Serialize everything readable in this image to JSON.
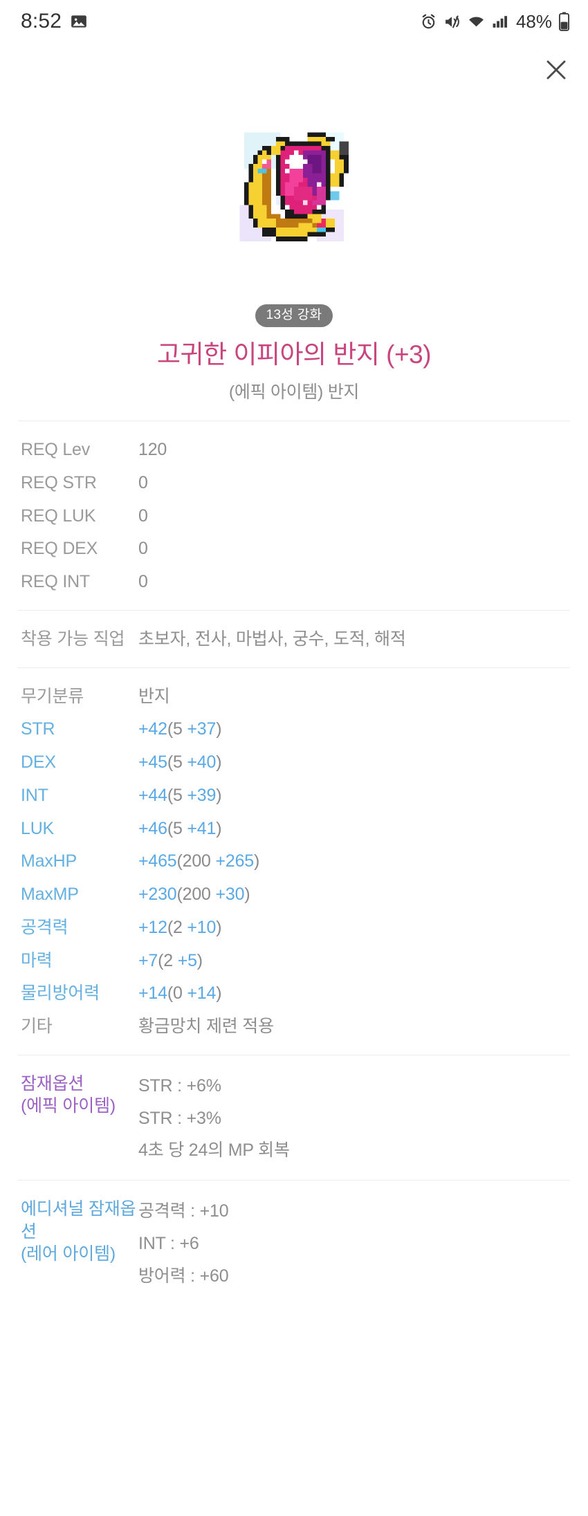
{
  "status_bar": {
    "time": "8:52",
    "battery_percent": "48%",
    "icons": [
      "image-icon",
      "alarm-icon",
      "mute-icon",
      "wifi-icon",
      "signal-icon",
      "battery-icon"
    ]
  },
  "header": {
    "close_label": "✕"
  },
  "item": {
    "icon_name": "epic-ring-item-icon",
    "star_badge": "13성 강화",
    "name": "고귀한 이피아의 반지 (+3)",
    "subtitle": "(에픽 아이템) 반지"
  },
  "requirements": [
    {
      "label": "REQ Lev",
      "value": "120"
    },
    {
      "label": "REQ STR",
      "value": "0"
    },
    {
      "label": "REQ LUK",
      "value": "0"
    },
    {
      "label": "REQ DEX",
      "value": "0"
    },
    {
      "label": "REQ INT",
      "value": "0"
    }
  ],
  "jobs": {
    "label": "착용 가능 직업",
    "value": "초보자, 전사, 마법사, 궁수, 도적, 해적"
  },
  "category": {
    "label": "무기분류",
    "value": "반지"
  },
  "stats": [
    {
      "label": "STR",
      "total": "+42",
      "base": "(5 ",
      "bonus": "+37",
      "close": ")"
    },
    {
      "label": "DEX",
      "total": "+45",
      "base": "(5 ",
      "bonus": "+40",
      "close": ")"
    },
    {
      "label": "INT",
      "total": "+44",
      "base": "(5 ",
      "bonus": "+39",
      "close": ")"
    },
    {
      "label": "LUK",
      "total": "+46",
      "base": "(5 ",
      "bonus": "+41",
      "close": ")"
    },
    {
      "label": "MaxHP",
      "total": "+465",
      "base": "(200 ",
      "bonus": "+265",
      "close": ")"
    },
    {
      "label": "MaxMP",
      "total": "+230",
      "base": "(200 ",
      "bonus": "+30",
      "close": ")"
    },
    {
      "label": "공격력",
      "total": "+12",
      "base": "(2 ",
      "bonus": "+10",
      "close": ")"
    },
    {
      "label": "마력",
      "total": "+7",
      "base": "(2 ",
      "bonus": "+5",
      "close": ")"
    },
    {
      "label": "물리방어력",
      "total": "+14",
      "base": "(0 ",
      "bonus": "+14",
      "close": ")"
    }
  ],
  "etc": {
    "label": "기타",
    "value": "황금망치 제련 적용"
  },
  "potential": {
    "label_line1": "잠재옵션",
    "label_line2": "(에픽 아이템)",
    "options": [
      "STR : +6%",
      "STR : +3%",
      "4초 당 24의 MP 회복"
    ]
  },
  "additional_potential": {
    "label_line1": "에디셔널 잠재옵션",
    "label_line2": "(레어 아이템)",
    "options": [
      "공격력 : +10",
      "INT : +6",
      "방어력 : +60"
    ]
  },
  "colors": {
    "title_pink": "#c8457e",
    "stat_blue": "#64b0e0",
    "potential_purple": "#9b62c4",
    "add_potential_blue": "#5fa9dd",
    "gray_text": "#8e8e8e",
    "badge_gray": "#7a7a7a"
  }
}
